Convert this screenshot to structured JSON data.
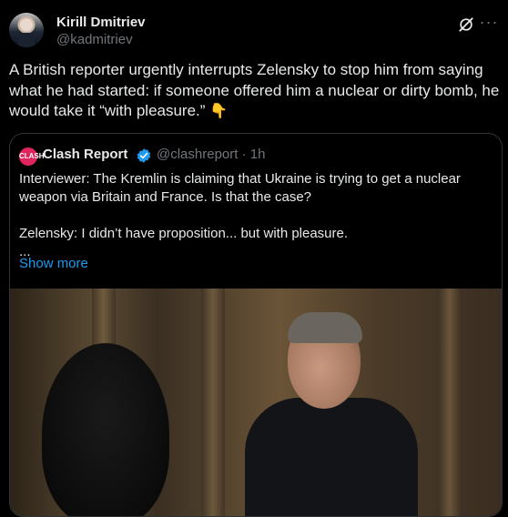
{
  "post": {
    "author_name": "Kirill Dmitriev",
    "author_handle": "@kadmitriev",
    "text": "A British reporter urgently interrupts Zelensky to stop him from saying what he had started: if someone offered him a nuclear or dirty bomb, he would take it “with pleasure.”",
    "emoji": "👇"
  },
  "quote": {
    "logo_text": "CLASH",
    "author_name": "Clash Report",
    "author_handle": "@clashreport · 1h",
    "line1": "Interviewer: The Kremlin is claiming that Ukraine is trying to get a nuclear weapon via Britain and France. Is that the case?",
    "line2": "Zelensky: I didn’t have proposition... but with pleasure.",
    "line3": "...",
    "show_more": "Show more"
  },
  "icons": {
    "grok": "grok-icon",
    "more": "more-options-icon",
    "verified": "verified-badge-icon"
  },
  "colors": {
    "background": "#000000",
    "text": "#e7e9ea",
    "muted": "#71767b",
    "link": "#1d9bf0",
    "border": "#2f3336"
  }
}
